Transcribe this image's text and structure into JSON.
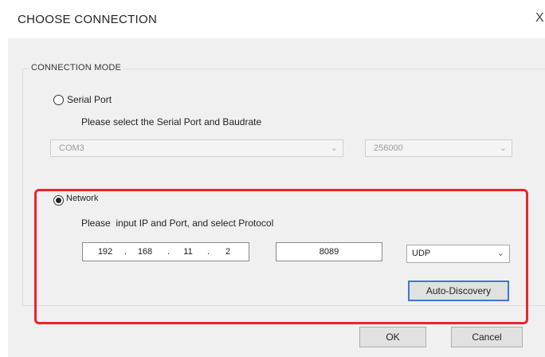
{
  "window": {
    "title": "CHOOSE CONNECTION",
    "close_glyph": "X"
  },
  "connection_mode": {
    "legend": "CONNECTION MODE",
    "serial": {
      "radio_label": "Serial Port",
      "checked": false,
      "hint": "Please select the Serial Port and Baudrate",
      "port_value": "COM3",
      "baud_value": "256000",
      "enabled": false
    },
    "network": {
      "radio_label": "Network",
      "checked": true,
      "hint": "Please  input IP and Port, and select Protocol",
      "ip": [
        "192",
        "168",
        "11",
        "2"
      ],
      "ip_separator": ".",
      "port": "8089",
      "protocol": "UDP",
      "auto_discovery_label": "Auto-Discovery"
    }
  },
  "buttons": {
    "ok_label": "OK",
    "cancel_label": "Cancel"
  },
  "icons": {
    "dropdown": "chevron-down-icon",
    "close": "close-icon"
  },
  "colors": {
    "highlight_border": "#e8262b",
    "focus_border": "#3b78d8"
  }
}
